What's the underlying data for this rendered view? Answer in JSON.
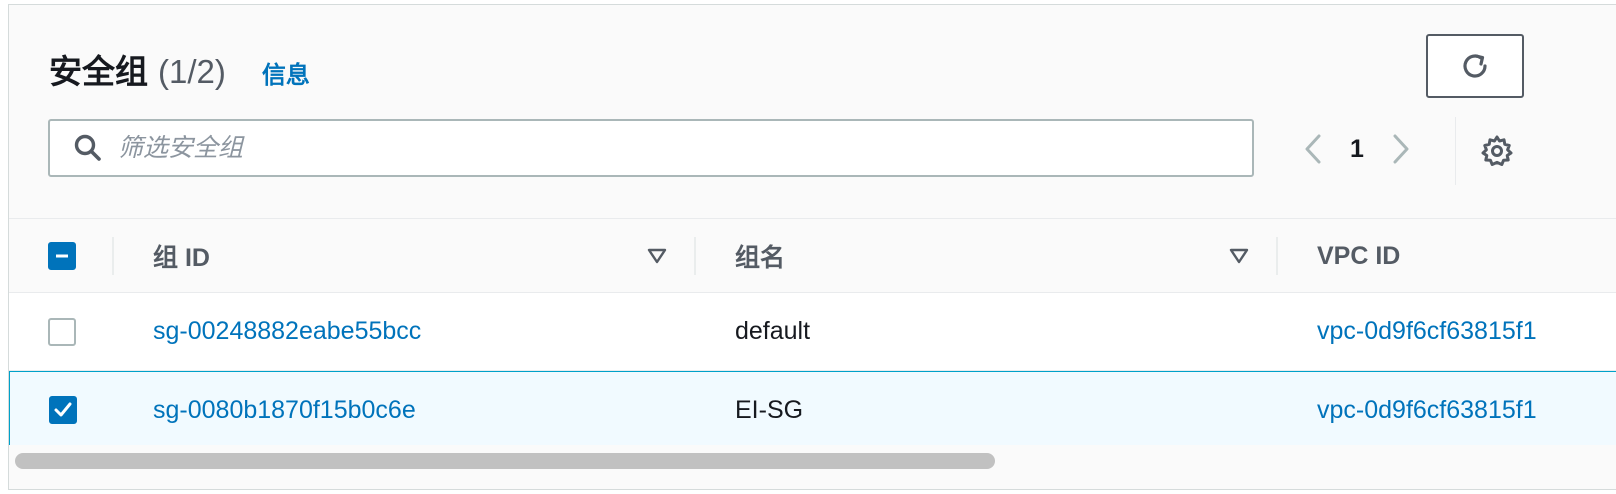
{
  "header": {
    "title": "安全组",
    "count": "(1/2)",
    "info_link": "信息"
  },
  "search": {
    "placeholder": "筛选安全组",
    "value": ""
  },
  "pagination": {
    "current_page": "1"
  },
  "table": {
    "columns": [
      {
        "label": "组 ID"
      },
      {
        "label": "组名"
      },
      {
        "label": "VPC ID"
      }
    ],
    "rows": [
      {
        "group_id": "sg-00248882eabe55bcc",
        "group_name": "default",
        "vpc_id": "vpc-0d9f6cf63815f1",
        "selected": false
      },
      {
        "group_id": "sg-0080b1870f15b0c6e",
        "group_name": "EI-SG",
        "vpc_id": "vpc-0d9f6cf63815f1",
        "selected": true
      }
    ]
  },
  "icons": {
    "refresh": "refresh-icon",
    "search": "search-icon",
    "prev": "chevron-left-icon",
    "next": "chevron-right-icon",
    "settings": "gear-icon",
    "sort": "caret-down-icon"
  },
  "colors": {
    "link": "#0073bb",
    "selected_row_bg": "#f1faff",
    "selected_row_border": "#00a1c9",
    "checkbox_checked": "#0073bb"
  }
}
